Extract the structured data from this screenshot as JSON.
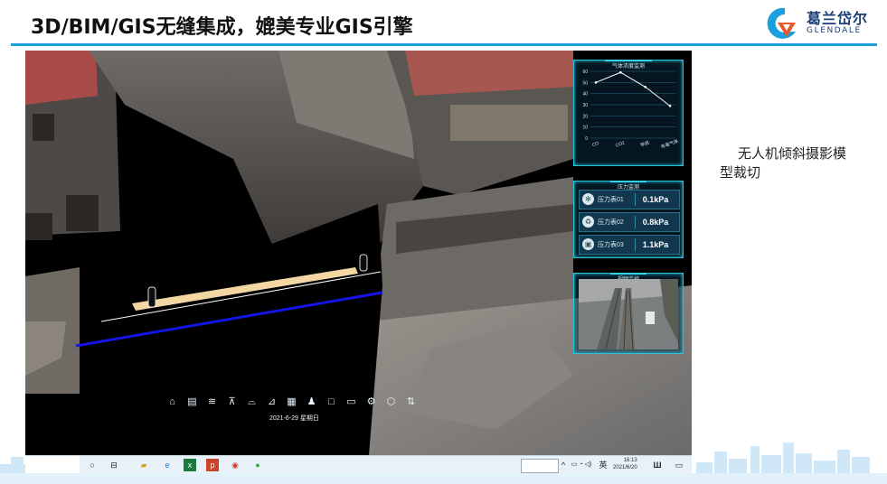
{
  "slide": {
    "title": "3D/BIM/GIS无缝集成，媲美专业GIS引擎",
    "caption": "无人机倾斜摄影模型裁切"
  },
  "logo": {
    "name_cn": "葛兰岱尔",
    "name_en": "GLENDALE"
  },
  "colors": {
    "accent": "#1aa0dc",
    "panel_border": "#2ac3d6",
    "cut_line": "#1414e6",
    "bar": "#f3d7a3"
  },
  "gas_panel": {
    "title": "气体浓度监测",
    "y_ticks": [
      "60",
      "50",
      "40",
      "30",
      "20",
      "10",
      "0"
    ],
    "chart_data": {
      "type": "line",
      "categories": [
        "CO",
        "CO2",
        "甲烷",
        "有毒气体"
      ],
      "values": [
        50,
        59,
        46,
        29
      ],
      "ylim": [
        0,
        60
      ],
      "grid": true
    }
  },
  "pressure_panel": {
    "title": "压力监测",
    "rows": [
      {
        "label": "压力表01",
        "value": "0.1kPa",
        "icon": "fan-icon"
      },
      {
        "label": "压力表02",
        "value": "0.8kPa",
        "icon": "recycle-icon"
      },
      {
        "label": "压力表03",
        "value": "1.1kPa",
        "icon": "meter-icon"
      }
    ]
  },
  "video_panel": {
    "title": "视频监控"
  },
  "toolbar": {
    "icons": [
      "home-icon",
      "save-icon",
      "layers-icon",
      "tree-icon",
      "tunnel-icon",
      "measure-icon",
      "grid-icon",
      "person-icon",
      "box-icon",
      "ruler-icon",
      "gear-icon",
      "cube-icon",
      "sync-icon"
    ],
    "date": "2021-6-29 星期日"
  },
  "taskbar": {
    "items": [
      "search-circle-icon",
      "task-view-icon",
      "file-explorer-icon",
      "edge-icon",
      "excel-icon",
      "powerpoint-icon",
      "chrome-icon",
      "wechat-icon"
    ],
    "ime": "英",
    "time": "16:13",
    "date": "2021/6/20"
  }
}
